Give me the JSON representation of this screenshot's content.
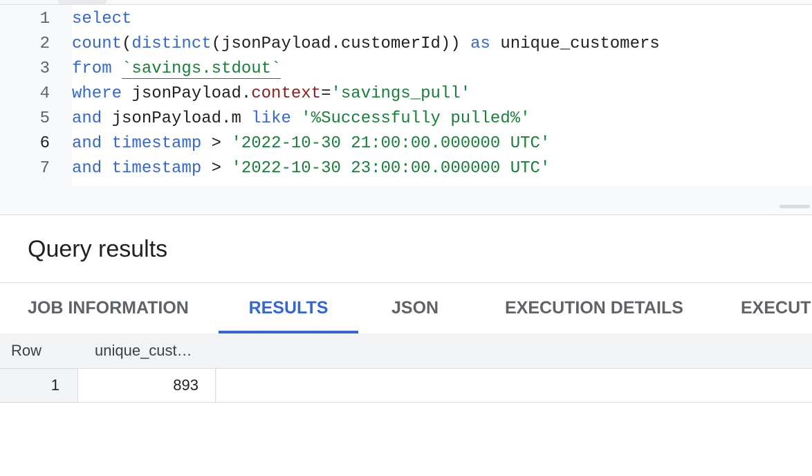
{
  "editor": {
    "lines": [
      {
        "number": "1",
        "tokens": [
          {
            "t": "kw",
            "v": "select"
          }
        ]
      },
      {
        "number": "2",
        "tokens": [
          {
            "t": "fn",
            "v": "count"
          },
          {
            "t": "op",
            "v": "("
          },
          {
            "t": "fn",
            "v": "distinct"
          },
          {
            "t": "op",
            "v": "("
          },
          {
            "t": "ident",
            "v": "jsonPayload.customerId"
          },
          {
            "t": "op",
            "v": "))"
          },
          {
            "t": "op",
            "v": " "
          },
          {
            "t": "kw",
            "v": "as"
          },
          {
            "t": "op",
            "v": " "
          },
          {
            "t": "ident",
            "v": "unique_customers"
          }
        ]
      },
      {
        "number": "3",
        "tokens": [
          {
            "t": "kw",
            "v": "from"
          },
          {
            "t": "op",
            "v": " "
          },
          {
            "t": "table",
            "v": "`savings.stdout`"
          }
        ]
      },
      {
        "number": "4",
        "tokens": [
          {
            "t": "kw",
            "v": "where"
          },
          {
            "t": "op",
            "v": " "
          },
          {
            "t": "ident",
            "v": "jsonPayload."
          },
          {
            "t": "field",
            "v": "context"
          },
          {
            "t": "op",
            "v": "="
          },
          {
            "t": "str",
            "v": "'savings_pull'"
          }
        ]
      },
      {
        "number": "5",
        "tokens": [
          {
            "t": "kw",
            "v": "and"
          },
          {
            "t": "op",
            "v": " "
          },
          {
            "t": "ident",
            "v": "jsonPayload.m"
          },
          {
            "t": "op",
            "v": " "
          },
          {
            "t": "kw",
            "v": "like"
          },
          {
            "t": "op",
            "v": " "
          },
          {
            "t": "str",
            "v": "'%Successfully pulled%'"
          }
        ]
      },
      {
        "number": "6",
        "active": true,
        "tokens": [
          {
            "t": "kw",
            "v": "and"
          },
          {
            "t": "op",
            "v": " "
          },
          {
            "t": "fn",
            "v": "timestamp"
          },
          {
            "t": "op",
            "v": " > "
          },
          {
            "t": "str",
            "v": "'2022-10-30 21:00:00.000000 UTC'"
          }
        ]
      },
      {
        "number": "7",
        "tokens": [
          {
            "t": "kw",
            "v": "and"
          },
          {
            "t": "op",
            "v": " "
          },
          {
            "t": "fn",
            "v": "timestamp"
          },
          {
            "t": "op",
            "v": " > "
          },
          {
            "t": "str",
            "v": "'2022-10-30 23:00:00.000000 UTC'"
          }
        ]
      }
    ]
  },
  "results": {
    "title": "Query results",
    "tabs": [
      {
        "label": "JOB INFORMATION",
        "active": false
      },
      {
        "label": "RESULTS",
        "active": true
      },
      {
        "label": "JSON",
        "active": false
      },
      {
        "label": "EXECUTION DETAILS",
        "active": false
      },
      {
        "label": "EXECUTI",
        "active": false
      }
    ],
    "table": {
      "headers": {
        "row": "Row",
        "col1": "unique_cust…"
      },
      "rows": [
        {
          "row": "1",
          "unique_customers": "893"
        }
      ]
    }
  },
  "colors": {
    "keyword": "#3367d6",
    "string": "#188038",
    "field": "#8b1f1f",
    "accent": "#3367d6"
  }
}
